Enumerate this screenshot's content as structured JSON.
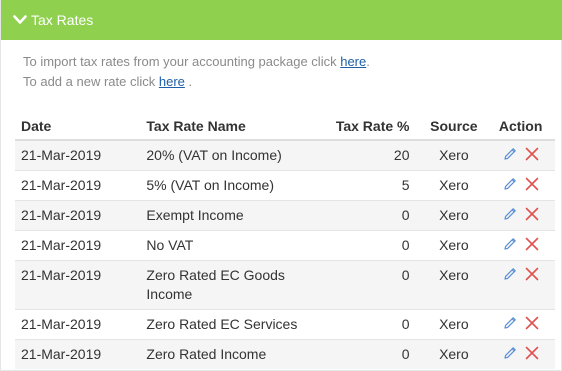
{
  "header": {
    "title": "Tax Rates",
    "icon": "chevron-down-icon",
    "background": "#8fd14f"
  },
  "intro": {
    "import_text": "To import tax rates from your accounting package click",
    "import_link": "here",
    "import_suffix": ".",
    "add_text": "To add a new rate click",
    "add_link": "here",
    "add_suffix": "."
  },
  "table": {
    "columns": [
      "Date",
      "Tax Rate Name",
      "Tax Rate %",
      "Source",
      "Action"
    ],
    "rows": [
      {
        "date": "21-Mar-2019",
        "name": "20% (VAT on Income)",
        "rate": "20",
        "source": "Xero"
      },
      {
        "date": "21-Mar-2019",
        "name": "5% (VAT on Income)",
        "rate": "5",
        "source": "Xero"
      },
      {
        "date": "21-Mar-2019",
        "name": "Exempt Income",
        "rate": "0",
        "source": "Xero"
      },
      {
        "date": "21-Mar-2019",
        "name": "No VAT",
        "rate": "0",
        "source": "Xero"
      },
      {
        "date": "21-Mar-2019",
        "name": "Zero Rated EC Goods Income",
        "rate": "0",
        "source": "Xero"
      },
      {
        "date": "21-Mar-2019",
        "name": "Zero Rated EC Services",
        "rate": "0",
        "source": "Xero"
      },
      {
        "date": "21-Mar-2019",
        "name": "Zero Rated Income",
        "rate": "0",
        "source": "Xero"
      }
    ]
  },
  "colors": {
    "edit": "#5b8fd6",
    "delete": "#e0524f"
  }
}
